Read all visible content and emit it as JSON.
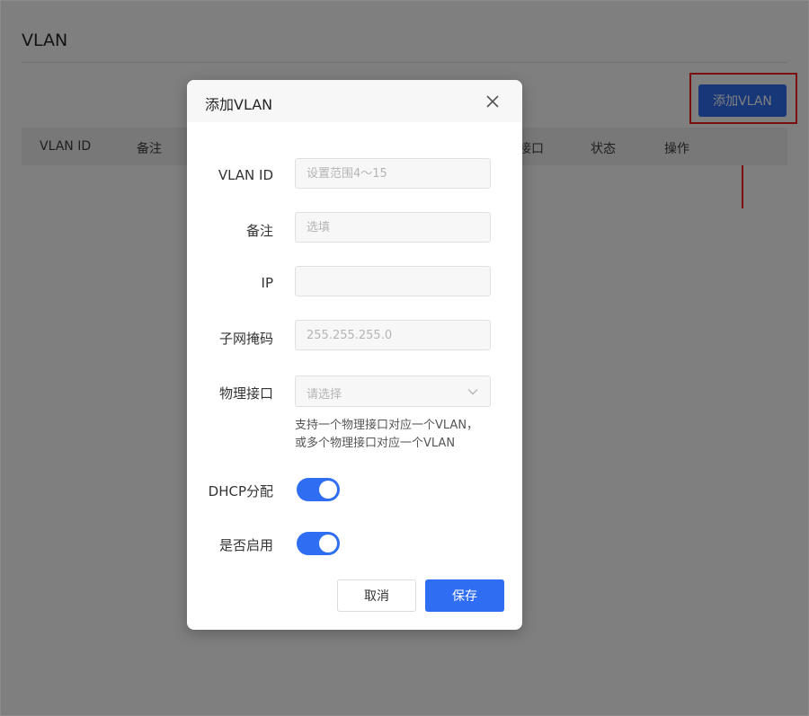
{
  "page": {
    "title": "VLAN",
    "add_button_label": "添加VLAN",
    "table_columns": [
      "VLAN ID",
      "备注",
      "接口",
      "状态",
      "操作"
    ]
  },
  "dialog": {
    "title": "添加VLAN",
    "fields": {
      "vlan_id": {
        "label": "VLAN ID",
        "value": "",
        "placeholder": "设置范围4～15"
      },
      "remark": {
        "label": "备注",
        "value": "",
        "placeholder": "选填"
      },
      "ip": {
        "label": "IP",
        "value": "",
        "placeholder": ""
      },
      "subnet_mask": {
        "label": "子网掩码",
        "value": "",
        "placeholder": "255.255.255.0"
      },
      "physical_port": {
        "label": "物理接口",
        "placeholder": "请选择"
      }
    },
    "hint_lines": [
      "支持一个物理接口对应一个VLAN，",
      "或多个物理接口对应一个VLAN"
    ],
    "dhcp": {
      "label": "DHCP分配",
      "on": true
    },
    "enabled": {
      "label": "是否启用",
      "on": true
    },
    "cancel_label": "取消",
    "save_label": "保存"
  },
  "colors": {
    "accent": "#2f6ef3",
    "highlight": "#f41f1f",
    "overlay": "rgba(0,0,0,0.5)"
  },
  "icons": [
    "close-icon",
    "chevron-down-icon",
    "arrow-up-icon"
  ]
}
